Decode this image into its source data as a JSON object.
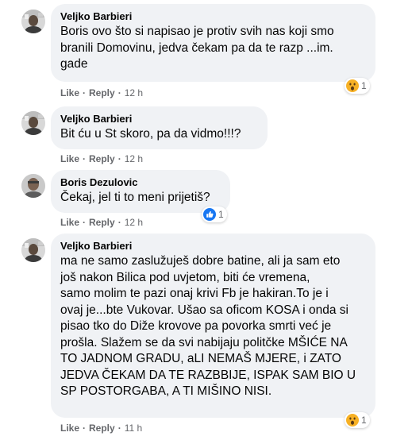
{
  "comments": [
    {
      "author": "Veljko Barbieri",
      "text": "Boris ovo što si napisao je protiv svih nas koji smo\nbranili Domovinu, jedva čekam pa da te razp ...im.\ngade",
      "like": "Like",
      "reply": "Reply",
      "time": "12 h",
      "reaction": {
        "type": "wow",
        "count": "1"
      }
    },
    {
      "author": "Veljko Barbieri",
      "text": "Bit ću u St skoro, pa da vidmo!!!?",
      "like": "Like",
      "reply": "Reply",
      "time": "12 h"
    },
    {
      "author": "Boris Dezulovic",
      "text": "Čekaj, jel ti to meni prijetiš?",
      "like": "Like",
      "reply": "Reply",
      "time": "12 h",
      "reaction": {
        "type": "like",
        "count": "1"
      }
    },
    {
      "author": "Veljko Barbieri",
      "text": "ma ne samo zaslužuješ dobre batine, ali ja sam eto\njoš nakon Bilica pod uvjetom, biti će vremena,\nsamo molim te pazi onaj krivi Fb je hakiran.To je i\novaj je...bte Vukovar. Ušao sa oficom KOSA i onda si\npisao tko do Diže krovove pa povorka smrti već je\nprošla. Slažem se da svi nabijaju politčke MŠIĆE NA\nTO JADNOM GRADU, aLI NEMAŠ MJERE, i ZATO\nJEDVA ČEKAM DA TE RAZBBIJE, ISPAK SAM BIO U\nSP POSTORGABA, A TI MIŠINO NISI.",
      "like": "Like",
      "reply": "Reply",
      "time": "11 h",
      "reaction": {
        "type": "wow",
        "count": "1"
      }
    }
  ],
  "colors": {
    "bubble": "#f0f2f5",
    "meta": "#65676b",
    "like_blue": "#1877f2",
    "wow_yellow": "#f7b125"
  }
}
